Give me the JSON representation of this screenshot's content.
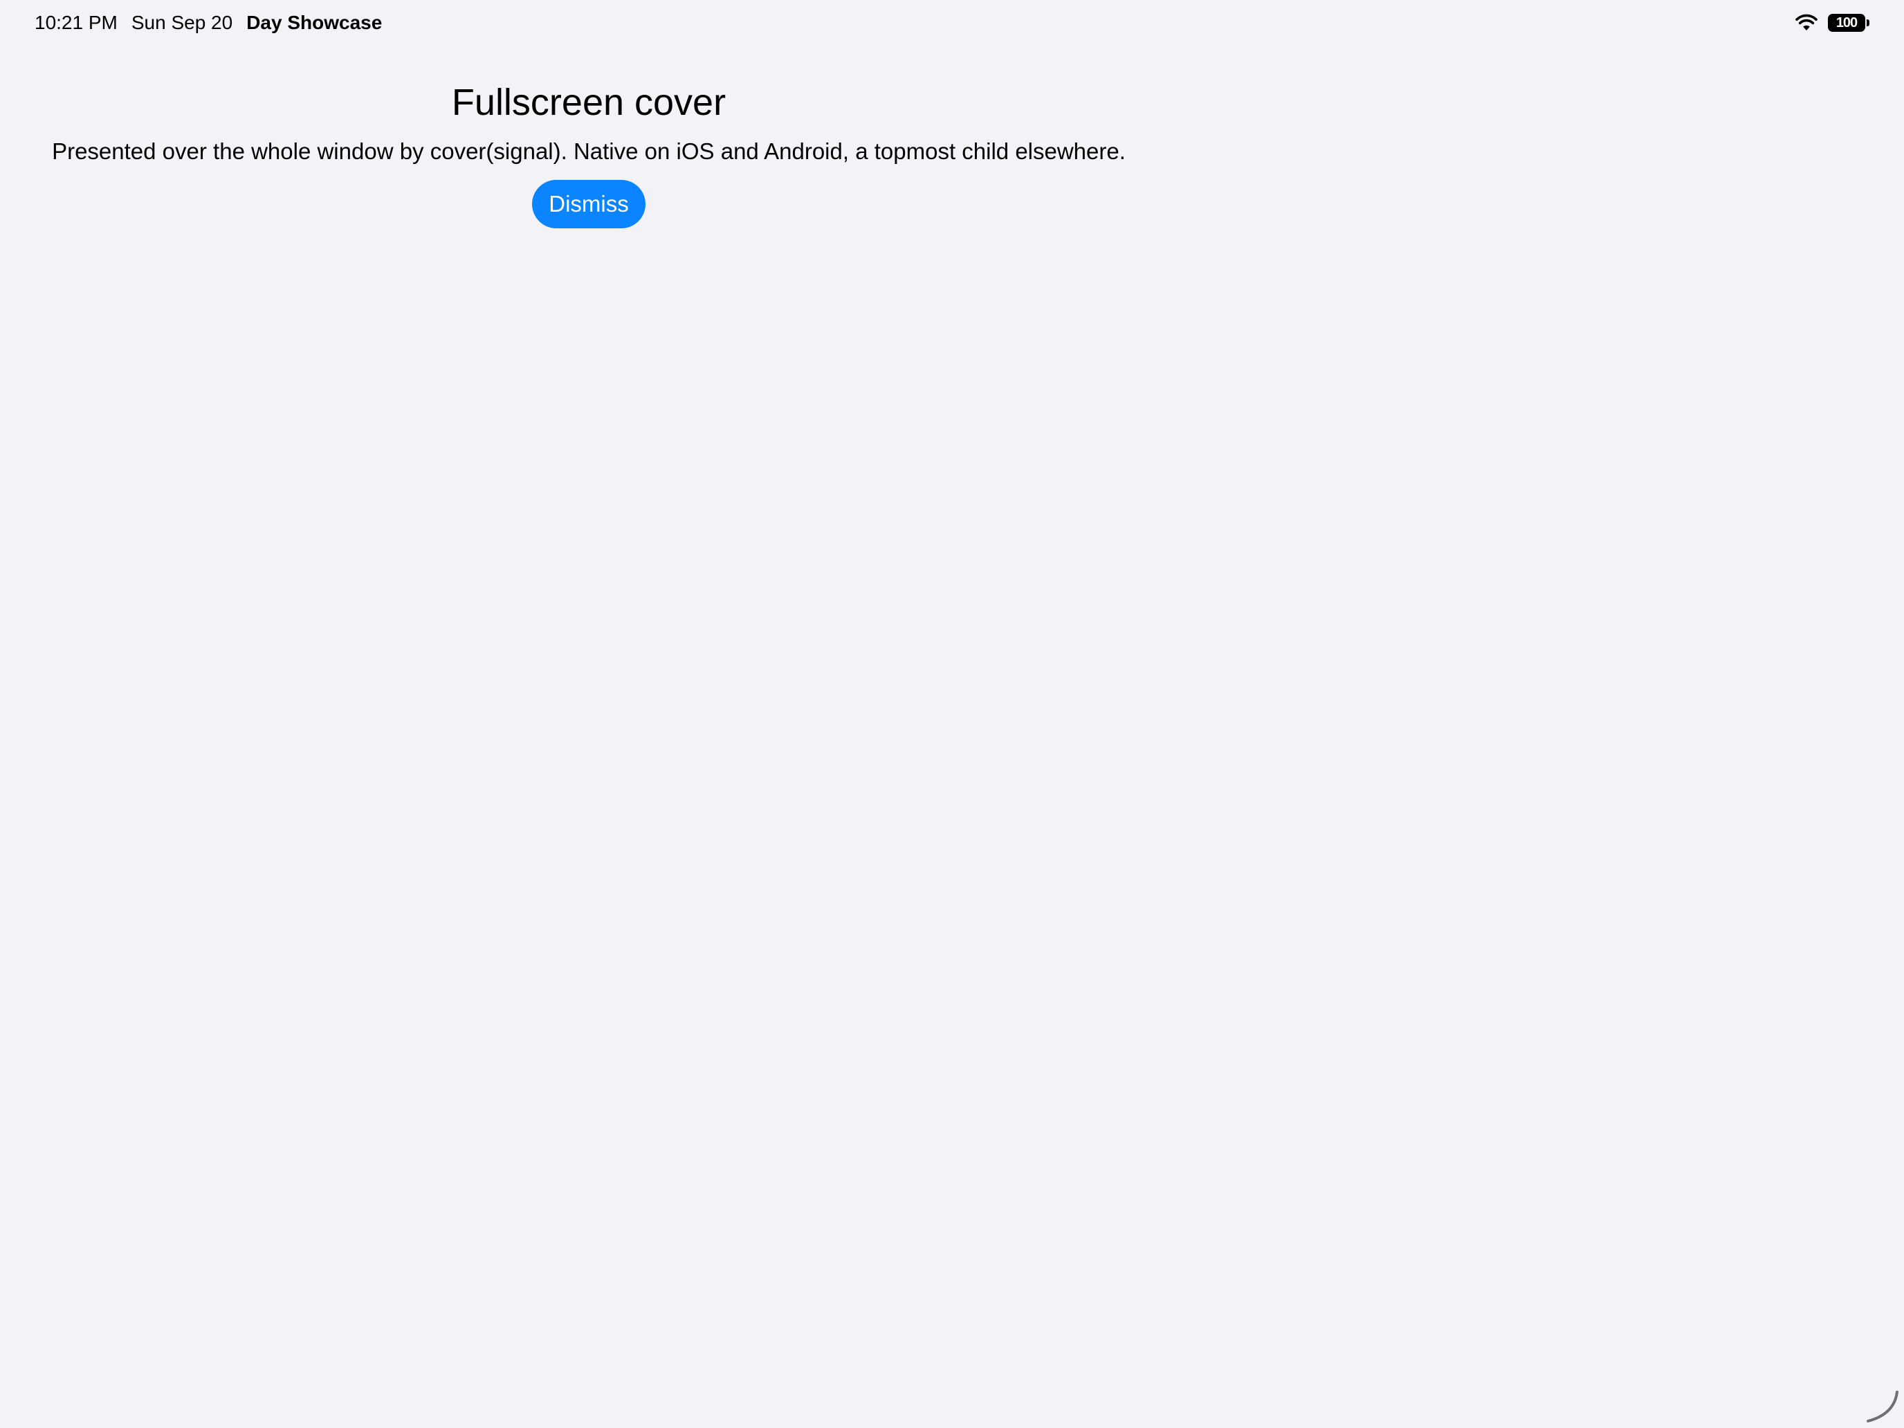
{
  "status_bar": {
    "time": "10:21 PM",
    "date": "Sun Sep 20",
    "app_name": "Day Showcase",
    "battery_level": "100",
    "wifi_icon": "wifi-icon",
    "battery_icon": "battery-icon"
  },
  "cover": {
    "title": "Fullscreen cover",
    "description": "Presented over the whole window by cover(signal). Native on iOS and Android, a topmost child elsewhere.",
    "dismiss_label": "Dismiss"
  },
  "colors": {
    "background": "#f2f2f7",
    "accent": "#0a84ff",
    "text": "#000000"
  }
}
